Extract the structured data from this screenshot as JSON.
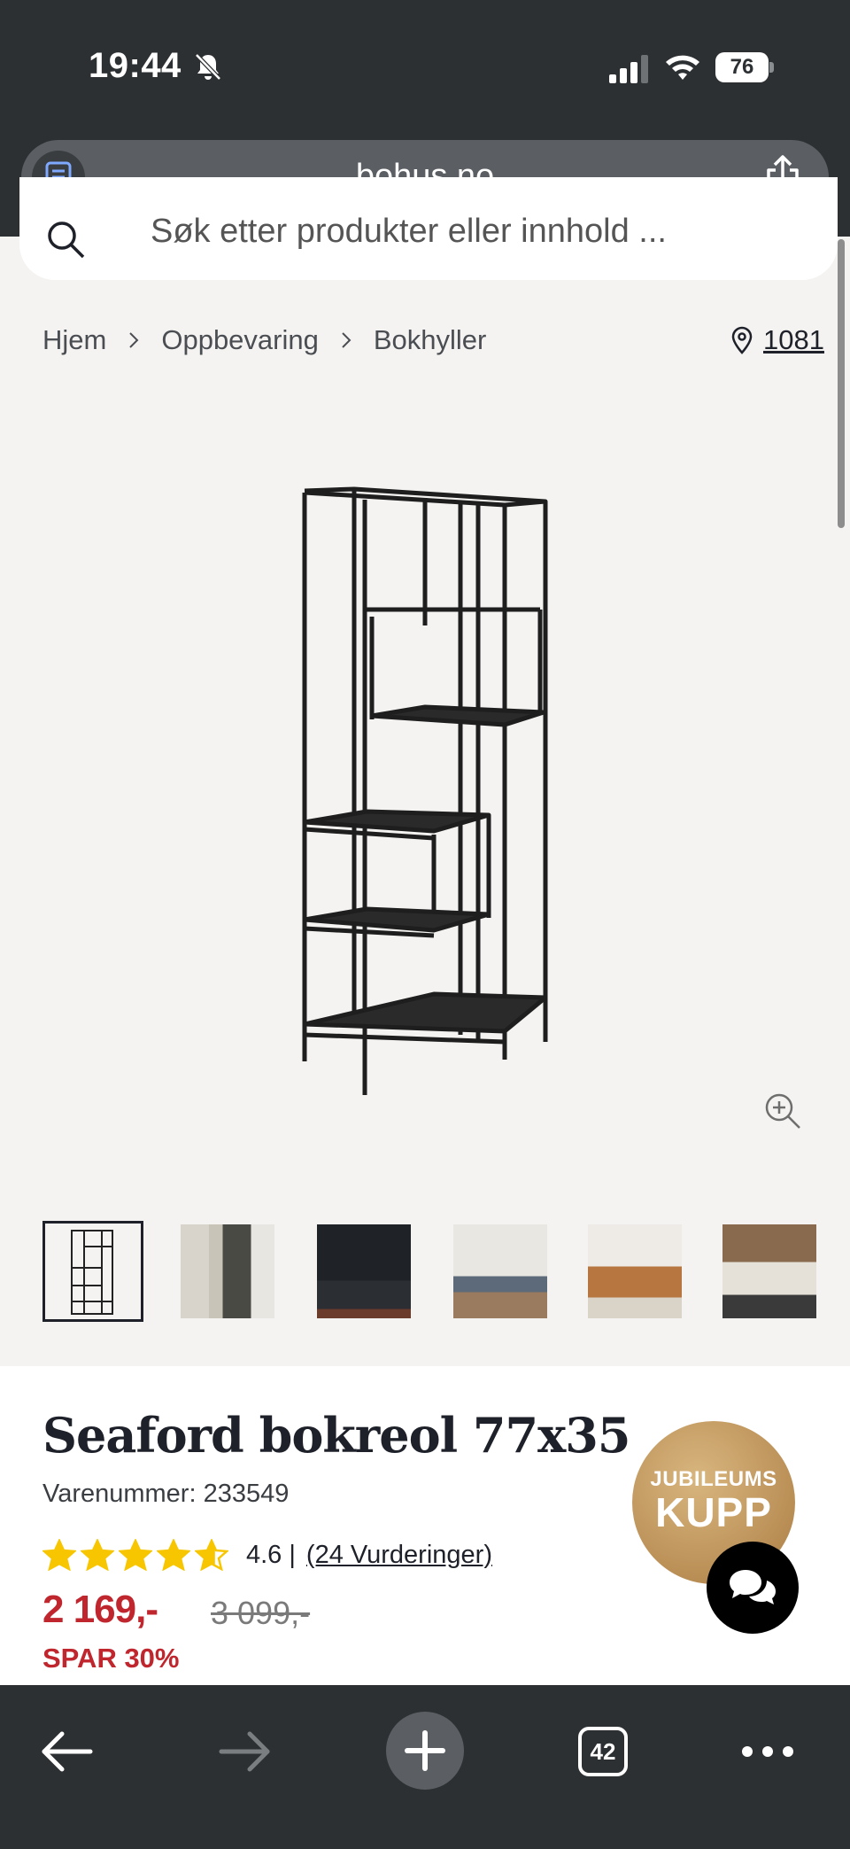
{
  "status_bar": {
    "time": "19:44",
    "battery": "76"
  },
  "browser": {
    "url": "bohus.no",
    "open_tabs": "42"
  },
  "search": {
    "placeholder": "Søk etter produkter eller innhold ..."
  },
  "breadcrumb": {
    "items": [
      "Hjem",
      "Oppbevaring",
      "Bokhyller"
    ]
  },
  "store": {
    "label": "1081"
  },
  "product": {
    "title": "Seaford bokreol 77x35",
    "sku": "Varenummer: 233549",
    "rating_value": 4.6,
    "rating_text": "4.6 |",
    "rating_count": "(24 Vurderinger)",
    "price": "2 169,-",
    "old_price": "3 099,-",
    "save": "SPAR 30%"
  },
  "badge": {
    "line1": "JUBILEUMS",
    "line2": "KUPP"
  },
  "thumbnails_count": 6,
  "icons": [
    "bell-off-icon",
    "signal-icon",
    "wifi-icon",
    "reader-icon",
    "share-icon",
    "search-icon",
    "chevron-right-icon",
    "location-pin-icon",
    "zoom-in-icon",
    "star-icon",
    "chat-icon",
    "back-arrow-icon",
    "forward-arrow-icon",
    "plus-icon",
    "more-icon"
  ],
  "colors": {
    "accent_red": "#c0262d",
    "star": "#f7c600",
    "chrome_dark": "#2d3033",
    "badge_gold": "#b98e55"
  }
}
